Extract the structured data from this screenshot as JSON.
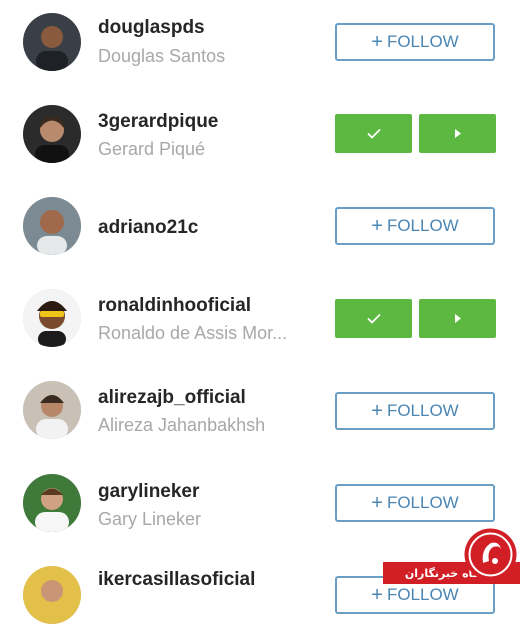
{
  "follow_label": "FOLLOW",
  "users": [
    {
      "username": "douglaspds",
      "fullname": "Douglas Santos",
      "state": "follow"
    },
    {
      "username": "3gerardpique",
      "fullname": "Gerard Piqué",
      "state": "following"
    },
    {
      "username": "adriano21c",
      "fullname": "",
      "state": "follow"
    },
    {
      "username": "ronaldinhooficial",
      "fullname": "Ronaldo de Assis Mor...",
      "state": "following"
    },
    {
      "username": "alirezajb_official",
      "fullname": "Alireza Jahanbakhsh",
      "state": "follow"
    },
    {
      "username": "garylineker",
      "fullname": "Gary Lineker",
      "state": "follow"
    },
    {
      "username": "ikercasillasoficial",
      "fullname": "",
      "state": "follow"
    }
  ],
  "watermark": {
    "text": "باشگاه خبرنگاران"
  },
  "colors": {
    "accent_green": "#5cb840",
    "follow_blue": "#4c86b3",
    "watermark_red": "#d21f26"
  },
  "icons": {
    "following": "check-icon",
    "more": "play-icon",
    "follow": "plus-icon"
  }
}
